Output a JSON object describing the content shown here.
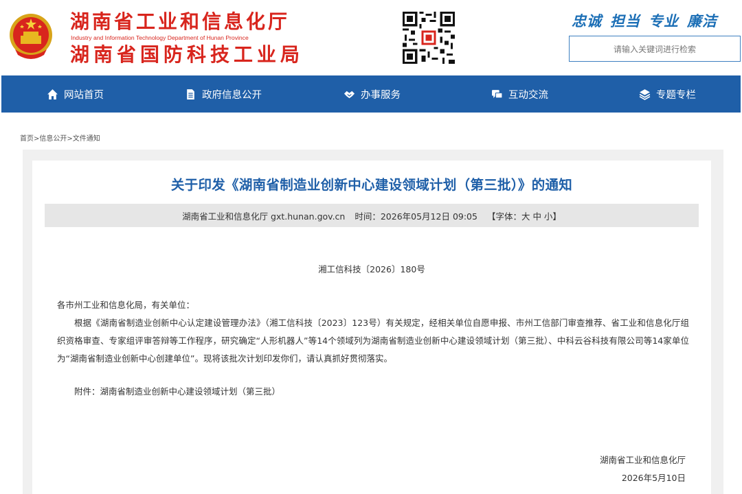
{
  "header": {
    "title_main": "湖南省工业和信息化厅",
    "title_en": "Industry and Information Technology Department of Hunan Province",
    "title_sub": "湖南省国防科技工业局",
    "slogans": [
      "忠诚",
      "担当",
      "专业",
      "廉洁"
    ],
    "search_placeholder": "请输入关键词进行检索"
  },
  "nav": {
    "items": [
      {
        "label": "网站首页",
        "icon": "home-icon"
      },
      {
        "label": "政府信息公开",
        "icon": "document-icon"
      },
      {
        "label": "办事服务",
        "icon": "handshake-icon"
      },
      {
        "label": "互动交流",
        "icon": "chat-icon"
      },
      {
        "label": "专题专栏",
        "icon": "layers-icon"
      }
    ]
  },
  "breadcrumb": "首页>信息公开>文件通知",
  "article": {
    "title": "关于印发《湖南省制造业创新中心建设领域计划（第三批）》的通知",
    "meta": {
      "source": "湖南省工业和信息化厅 gxt.hunan.gov.cn",
      "time": "时间：2026年05月12日 09:05",
      "font_size": "【字体：大 中 小】"
    },
    "doc_no": "湘工信科技〔2026〕180号",
    "salutation": "各市州工业和信息化局，有关单位：",
    "body": "根据《湖南省制造业创新中心认定建设管理办法》（湘工信科技〔2023〕123号）有关规定，经相关单位自愿申报、市州工信部门审查推荐、省工业和信息化厅组织资格审查、专家组评审答辩等工作程序，研究确定“人形机器人”等14个领域列为湖南省制造业创新中心建设领域计划（第三批）、中科云谷科技有限公司等14家单位为“湖南省制造业创新中心创建单位”。现将该批次计划印发你们，请认真抓好贯彻落实。",
    "attachment": "附件：湖南省制造业创新中心建设领域计划（第三批）",
    "sign_org": "湖南省工业和信息化厅",
    "sign_date": "2026年5月10日"
  },
  "colors": {
    "brand_red": "#d8251d",
    "nav_blue": "#1f5fa8",
    "title_blue": "#1f5fa8"
  }
}
